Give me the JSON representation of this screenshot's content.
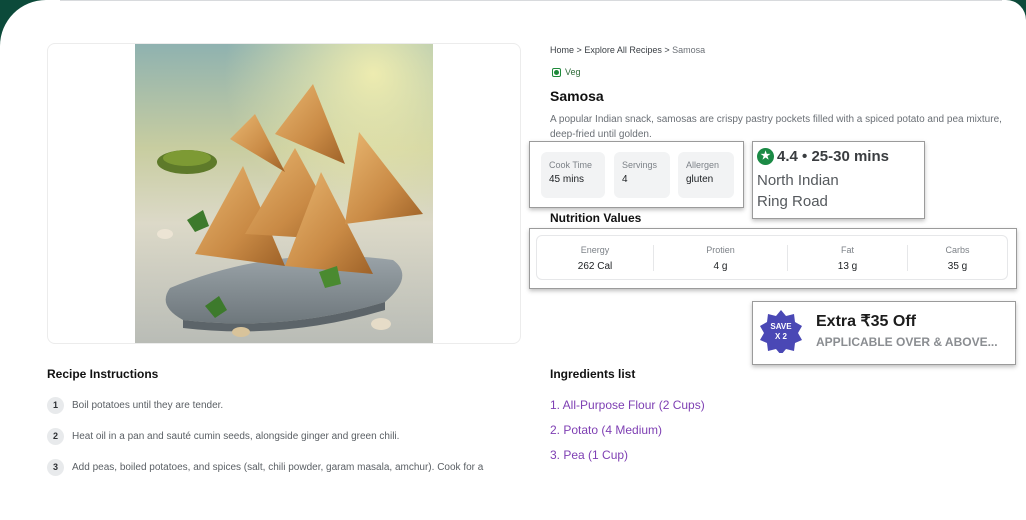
{
  "breadcrumb": {
    "home": "Home",
    "sep1": ">",
    "explore": "Explore All Recipes",
    "sep2": ">",
    "current": "Samosa"
  },
  "recipe": {
    "veg_label": "Veg",
    "title": "Samosa",
    "description": "A popular Indian snack, samosas are crispy pastry pockets filled with a spiced potato and pea mixture, deep-fried until golden.",
    "info": [
      {
        "label": "Cook Time",
        "value": "45 mins"
      },
      {
        "label": "Servings",
        "value": "4"
      },
      {
        "label": "Allergen",
        "value": "gluten"
      }
    ]
  },
  "restaurant": {
    "rating_line": "4.4 • 25-30 mins",
    "cuisine": "North Indian",
    "locality": "Ring Road"
  },
  "nutrition": {
    "title": "Nutrition Values",
    "items": [
      {
        "label": "Energy",
        "value": "262 Cal"
      },
      {
        "label": "Protien",
        "value": "4 g"
      },
      {
        "label": "Fat",
        "value": "13 g"
      },
      {
        "label": "Carbs",
        "value": "35 g"
      }
    ]
  },
  "offer": {
    "badge_line1": "SAVE",
    "badge_line2": "X 2",
    "title": "Extra ₹35 Off",
    "subtitle": "APPLICABLE OVER & ABOVE..."
  },
  "instructions": {
    "title": "Recipe Instructions",
    "steps": [
      {
        "num": "1",
        "text": "Boil potatoes until they are tender."
      },
      {
        "num": "2",
        "text": "Heat oil in a pan and sauté cumin seeds, alongside ginger and green chili."
      },
      {
        "num": "3",
        "text": "Add peas, boiled potatoes, and spices (salt, chili powder, garam masala, amchur). Cook for a"
      }
    ]
  },
  "ingredients": {
    "title": "Ingredients list",
    "items": [
      "1. All-Purpose Flour (2 Cups)",
      "2. Potato (4 Medium)",
      "3. Pea (1 Cup)"
    ]
  },
  "colors": {
    "accent_green": "#1b8a45",
    "ingredient_purple": "#7e3fb3",
    "badge_purple": "#4a48b5",
    "frame_dark_green": "#0c4a3a"
  }
}
